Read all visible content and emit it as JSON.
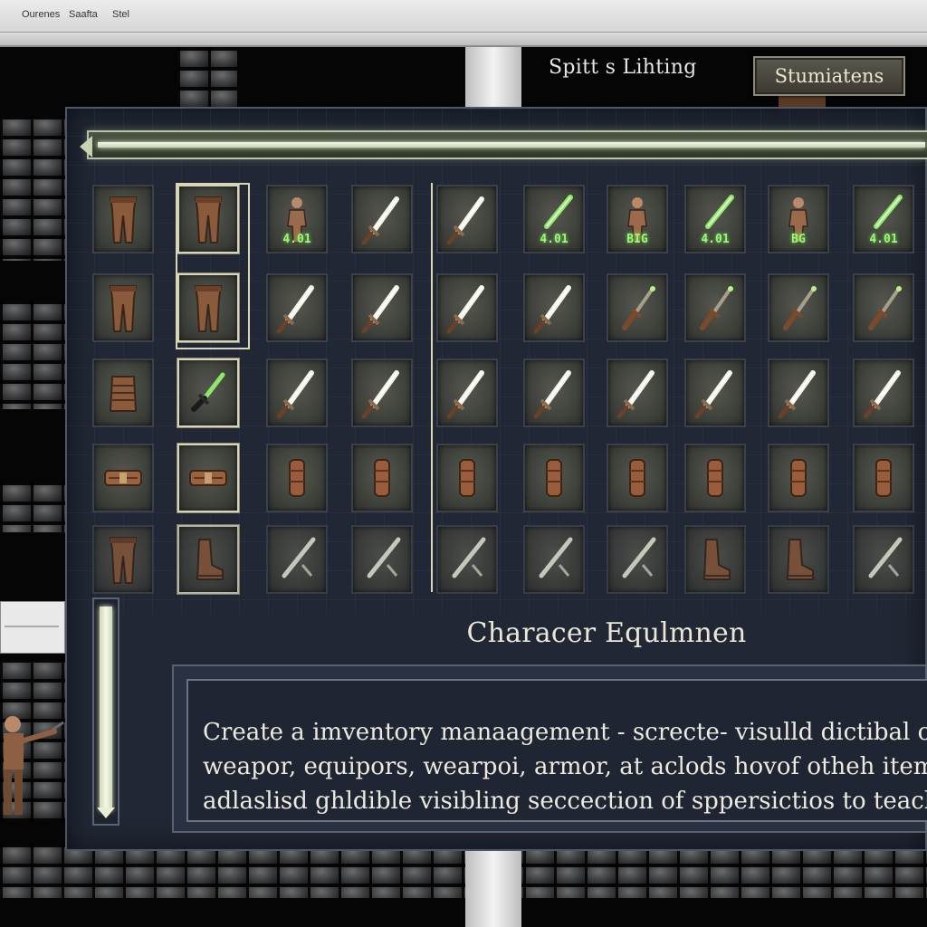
{
  "window": {
    "menu": [
      "Ourenes",
      "Saafta",
      "Stel"
    ]
  },
  "hud": {
    "title": "Spitt s Lihting",
    "button_label": "Stumiatens"
  },
  "inventory": {
    "rows": [
      [
        {
          "icon": "leather-leggings-icon",
          "badge": ""
        },
        {
          "icon": "leather-leggings-icon",
          "badge": "",
          "selected": true
        },
        {
          "icon": "humanoid-figure-icon",
          "badge": "4.01"
        },
        {
          "icon": "glowing-sword-icon",
          "badge": ""
        },
        {
          "icon": "glowing-sword-icon",
          "badge": ""
        },
        {
          "icon": "green-blade-icon",
          "badge": "4.01"
        },
        {
          "icon": "humanoid-figure-icon",
          "badge": "BIG"
        },
        {
          "icon": "green-blade-icon",
          "badge": "4.01"
        },
        {
          "icon": "humanoid-figure-icon",
          "badge": "BG"
        },
        {
          "icon": "green-blade-icon",
          "badge": "4.01"
        }
      ],
      [
        {
          "icon": "leather-leggings-icon",
          "badge": ""
        },
        {
          "icon": "leather-leggings-icon",
          "badge": "",
          "selected": true
        },
        {
          "icon": "glowing-sword-icon",
          "badge": ""
        },
        {
          "icon": "glowing-sword-icon",
          "badge": ""
        },
        {
          "icon": "glowing-sword-icon",
          "badge": ""
        },
        {
          "icon": "glowing-sword-icon",
          "badge": ""
        },
        {
          "icon": "dagger-icon",
          "badge": ""
        },
        {
          "icon": "dagger-icon",
          "badge": ""
        },
        {
          "icon": "dagger-icon",
          "badge": ""
        },
        {
          "icon": "dagger-icon",
          "badge": ""
        }
      ],
      [
        {
          "icon": "chest-armor-icon",
          "badge": ""
        },
        {
          "icon": "green-dagger-icon",
          "badge": "",
          "selected": true
        },
        {
          "icon": "glowing-sword-icon",
          "badge": ""
        },
        {
          "icon": "glowing-sword-icon",
          "badge": ""
        },
        {
          "icon": "glowing-sword-icon",
          "badge": ""
        },
        {
          "icon": "glowing-sword-icon",
          "badge": ""
        },
        {
          "icon": "glowing-sword-icon",
          "badge": ""
        },
        {
          "icon": "glowing-sword-icon",
          "badge": ""
        },
        {
          "icon": "glowing-sword-icon",
          "badge": ""
        },
        {
          "icon": "glowing-sword-icon",
          "badge": ""
        }
      ],
      [
        {
          "icon": "belt-icon",
          "badge": ""
        },
        {
          "icon": "belt-icon",
          "badge": "",
          "selected": true
        },
        {
          "icon": "bracer-icon",
          "badge": ""
        },
        {
          "icon": "bracer-icon",
          "badge": ""
        },
        {
          "icon": "bracer-icon",
          "badge": ""
        },
        {
          "icon": "bracer-icon",
          "badge": ""
        },
        {
          "icon": "bracer-icon",
          "badge": ""
        },
        {
          "icon": "bracer-icon",
          "badge": ""
        },
        {
          "icon": "bracer-icon",
          "badge": ""
        },
        {
          "icon": "bracer-icon",
          "badge": ""
        }
      ],
      [
        {
          "icon": "leather-leggings-icon",
          "badge": ""
        },
        {
          "icon": "boots-icon",
          "badge": "",
          "selected": true
        },
        {
          "icon": "staff-icon",
          "badge": ""
        },
        {
          "icon": "staff-icon",
          "badge": ""
        },
        {
          "icon": "staff-icon",
          "badge": ""
        },
        {
          "icon": "staff-icon",
          "badge": ""
        },
        {
          "icon": "staff-icon",
          "badge": ""
        },
        {
          "icon": "boots-icon",
          "badge": ""
        },
        {
          "icon": "boots-icon",
          "badge": ""
        },
        {
          "icon": "staff-icon",
          "badge": ""
        }
      ]
    ]
  },
  "section": {
    "title": "Characer Equlmnen"
  },
  "description": {
    "lines": [
      "Create a imventory  manaagement - screcte- visulld dictibal of m",
      "weapor, equipors, wearpoi, armor, at aclods hovof otheh items & c",
      "adlaslisd ghldible visibling seccection of sppersictios to teach item"
    ]
  },
  "colors": {
    "panel": "#222836",
    "accent_glow": "#9df57a",
    "selection": "#d9d6b8"
  }
}
